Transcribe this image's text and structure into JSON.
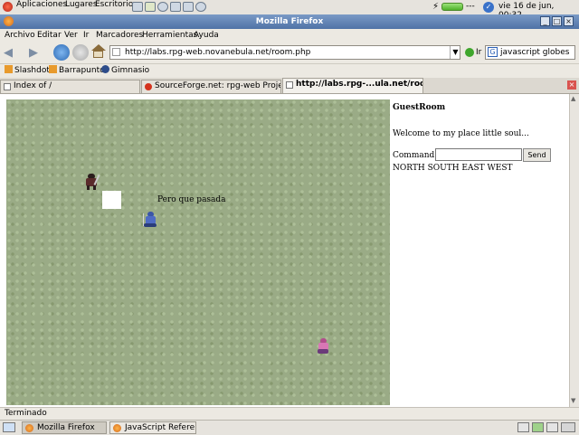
{
  "top_panel": {
    "menus": [
      "Aplicaciones",
      "Lugares",
      "Escritorio"
    ],
    "battery_text": "---",
    "clock": "vie 16 de jun, 00:32"
  },
  "window": {
    "title": "Mozilla Firefox"
  },
  "menubar": [
    "Archivo",
    "Editar",
    "Ver",
    "Ir",
    "Marcadores",
    "Herramientas",
    "Ayuda"
  ],
  "nav": {
    "url": "http://labs.rpg-web.novanebula.net/room.php",
    "go_label": "Ir",
    "search_value": "javascript globes"
  },
  "bookmarks": [
    "Slashdot",
    "Barrapunto",
    "Gimnasio"
  ],
  "tabs": [
    {
      "label": "Index of /",
      "active": false
    },
    {
      "label": "SourceForge.net: rpg-web Project: ...",
      "active": false
    },
    {
      "label": "http://labs.rpg-...ula.net/room.php",
      "active": true
    }
  ],
  "game": {
    "speech": "Pero que pasada"
  },
  "room": {
    "name": "GuestRoom",
    "welcome": "Welcome to my place little soul...",
    "command_label": "Command:",
    "command_value": "",
    "send_label": "Send",
    "exits": "NORTH SOUTH EAST WEST"
  },
  "status": "Terminado",
  "taskbar": [
    {
      "label": "Mozilla Firefox",
      "active": true
    },
    {
      "label": "JavaScript Refere...",
      "active": false
    }
  ],
  "colors": {
    "titlebar": "#5a7cb0",
    "game_ground": "#9aab86"
  }
}
